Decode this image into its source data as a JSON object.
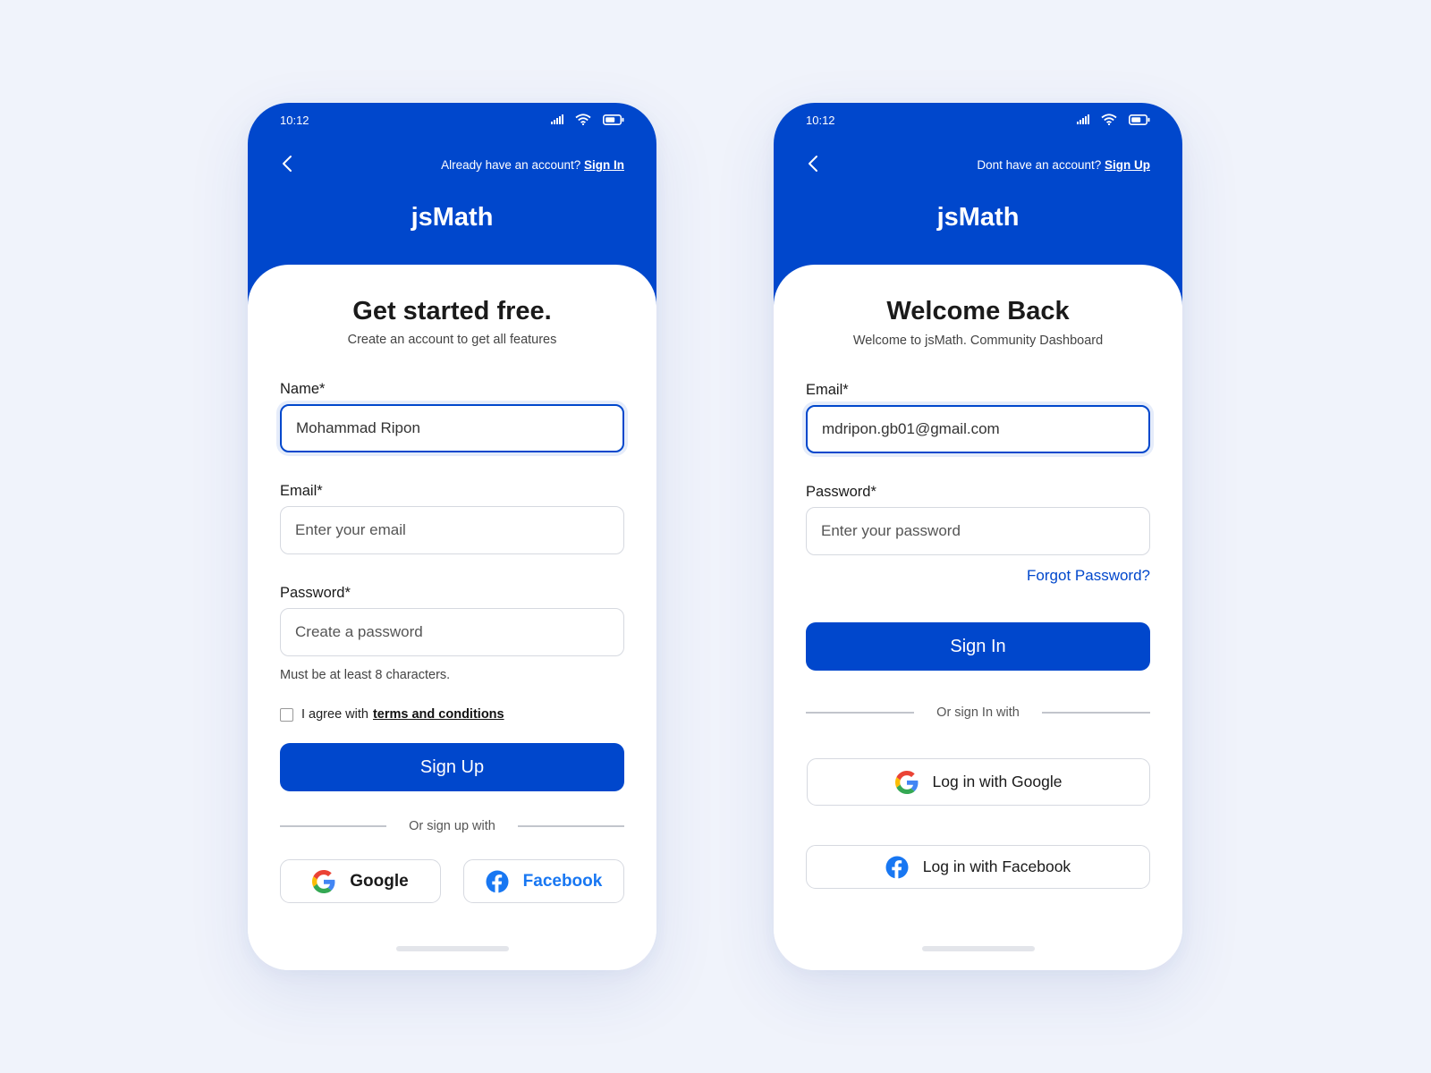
{
  "colors": {
    "primary": "#0047cc",
    "background": "#f0f3fb",
    "card": "#ffffff",
    "facebook": "#1877f2"
  },
  "signup": {
    "status_time": "10:12",
    "account_prompt": "Already have an account?",
    "account_link": "Sign In",
    "brand": "jsMath",
    "title": "Get started free.",
    "subtitle": "Create an account to get all features",
    "name_label": "Name*",
    "name_value": "Mohammad Ripon",
    "email_label": "Email*",
    "email_placeholder": "Enter your email",
    "password_label": "Password*",
    "password_placeholder": "Create a password",
    "password_hint": "Must be at least 8 characters.",
    "agree_text": "I agree with",
    "terms_link": "terms and conditions",
    "submit_label": "Sign Up",
    "divider_text": "Or sign up with",
    "google_label": "Google",
    "facebook_label": "Facebook"
  },
  "signin": {
    "status_time": "10:12",
    "account_prompt": "Dont have an account?",
    "account_link": "Sign Up",
    "brand": "jsMath",
    "title": "Welcome Back",
    "subtitle": "Welcome to jsMath. Community Dashboard",
    "email_label": "Email*",
    "email_value": "mdripon.gb01@gmail.com",
    "password_label": "Password*",
    "password_placeholder": "Enter your password",
    "forgot_label": "Forgot Password?",
    "submit_label": "Sign In",
    "divider_text": "Or sign In with",
    "google_label": "Log in with Google",
    "facebook_label": "Log in with Facebook"
  },
  "icons": [
    "signal-icon",
    "wifi-icon",
    "battery-icon",
    "back-arrow-icon",
    "google-icon",
    "facebook-icon"
  ]
}
